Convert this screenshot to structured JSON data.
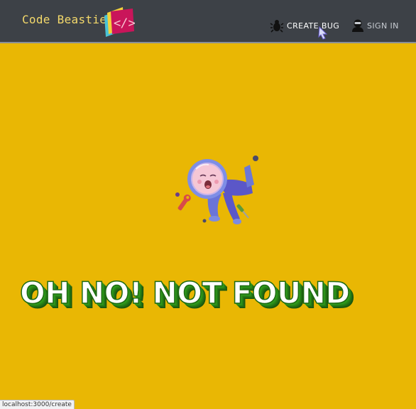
{
  "header": {
    "brand": "Code Beasties",
    "logo_icon": "code-tag-icon",
    "nav": [
      {
        "label": "CREATE BUG",
        "icon": "bug-icon"
      },
      {
        "label": "SIGN IN",
        "icon": "user-icon"
      }
    ]
  },
  "main": {
    "illustration": "floating-astronaut-illustration",
    "message": "OH NO! NOT FOUND"
  },
  "status_bar": {
    "url": "localhost:3000/create"
  },
  "colors": {
    "page_background": "#e9b704",
    "header_background": "#3d4147",
    "brand_text": "#f4d96b",
    "message_fill": "#ffffff",
    "message_3d": "#2f9a1c"
  }
}
